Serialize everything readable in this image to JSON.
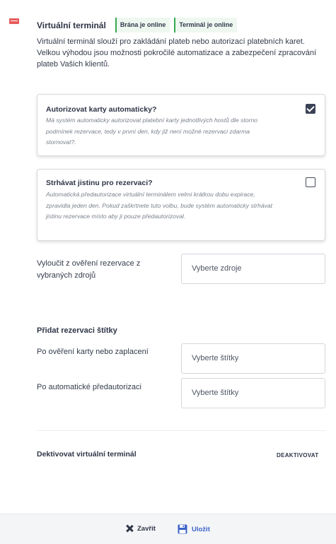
{
  "header": {
    "icon": "credit-card-icon",
    "title": "Virtuální terminál",
    "badge_gateway": "Brána je online",
    "badge_terminal": "Terminál je online"
  },
  "intro": "Virtuální terminál slouží pro zakládání plateb nebo autorizací platebních karet. Velkou výhodou jsou možnosti pokročilé automatizace a zabezpečení zpracování plateb Vašich klientů.",
  "options": [
    {
      "title": "Autorizovat karty automaticky?",
      "description": "Má systém automaticky autorizovat platební karty jednotlivých hostů dle storno podmínek rezervace, tedy v první den, kdy již není možné rezervaci zdarma stornovat?.",
      "checked": true
    },
    {
      "title": "Strhávat jistinu pro rezervaci?",
      "description": "Automatická předautorizace virtuální terminálem velmi krátkou dobu expirace, zpravidla jeden den. Pokud zaškrtnete tuto volbu, bude systém automaticky strhávat jistinu rezervace místo aby ji pouze předautorizoval.",
      "checked": false
    }
  ],
  "exclude": {
    "label": "Vyloučit z ověření rezervace z vybraných zdrojů",
    "placeholder": "Vyberte zdroje"
  },
  "tags": {
    "section_title": "Přidat rezervaci štítky",
    "after_verify_label": "Po ověření karty nebo zaplacení",
    "after_verify_placeholder": "Vyberte štítky",
    "after_preauth_label": "Po automatické předautorizaci",
    "after_preauth_placeholder": "Vyberte štítky"
  },
  "deactivate": {
    "label": "Dektivovat virtuální terminál",
    "button": "DEAKTIVOVAT"
  },
  "footer": {
    "close_label": "Zavřít",
    "save_label": "Uložit"
  },
  "colors": {
    "online_green": "#36a852",
    "save_blue": "#3d63c9",
    "card_red": "#e65a5a"
  }
}
